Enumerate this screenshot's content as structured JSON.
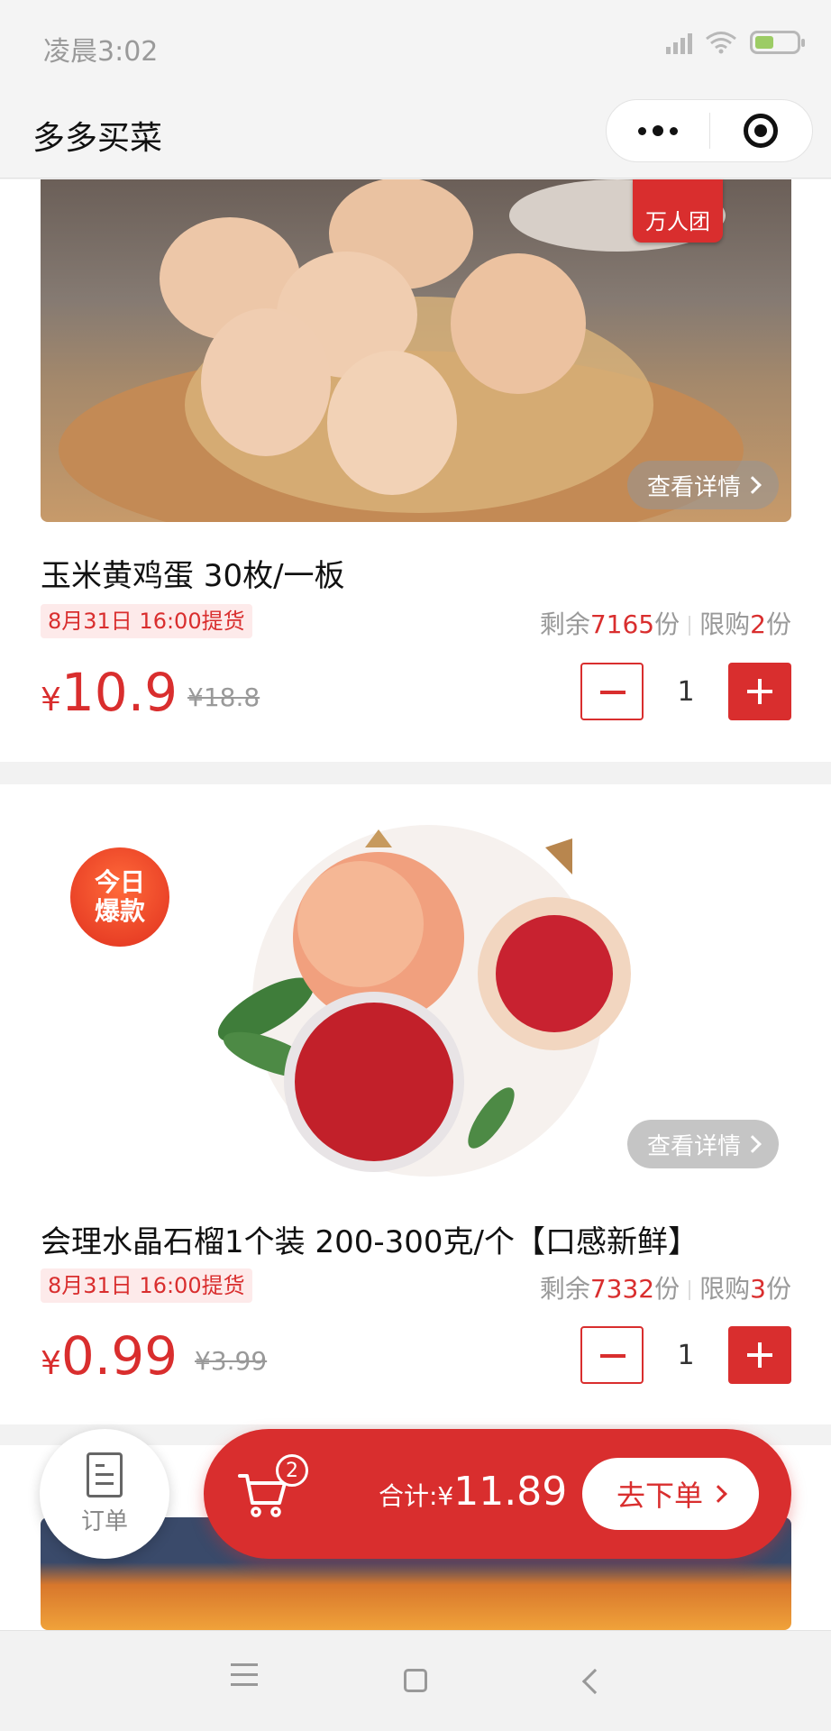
{
  "status_bar": {
    "time": "凌晨3:02"
  },
  "nav": {
    "title": "多多买菜"
  },
  "products": [
    {
      "title": "玉米黄鸡蛋  30枚/一板",
      "badge": "万人团",
      "detail_label": "查看详情",
      "pickup": "8月31日 16:00提货",
      "stock_prefix": "剩余",
      "stock_value": "7165",
      "stock_unit": "份",
      "limit_prefix": "限购",
      "limit_value": "2",
      "limit_unit": "份",
      "price_symbol": "¥",
      "price": "10.9",
      "old_price": "¥18.8",
      "quantity": "1"
    },
    {
      "title": "会理水晶石榴1个装  200-300克/个【口感新鲜】",
      "badge": "今日爆款",
      "detail_label": "查看详情",
      "pickup": "8月31日 16:00提货",
      "stock_prefix": "剩余",
      "stock_value": "7332",
      "stock_unit": "份",
      "limit_prefix": "限购",
      "limit_value": "3",
      "limit_unit": "份",
      "price_symbol": "¥",
      "price": "0.99",
      "old_price": "¥3.99",
      "quantity": "1"
    }
  ],
  "cart": {
    "order_label": "订单",
    "count": "2",
    "total_label": "合计:¥",
    "total_value": "11.89",
    "checkout_label": "去下单"
  },
  "colors": {
    "accent": "#d92e2e",
    "background": "#f2f2f2"
  },
  "icons": [
    "signal-icon",
    "wifi-icon",
    "battery-icon",
    "more-icon",
    "target-icon",
    "cart-icon",
    "order-icon",
    "menu-icon",
    "home-icon",
    "back-icon"
  ]
}
